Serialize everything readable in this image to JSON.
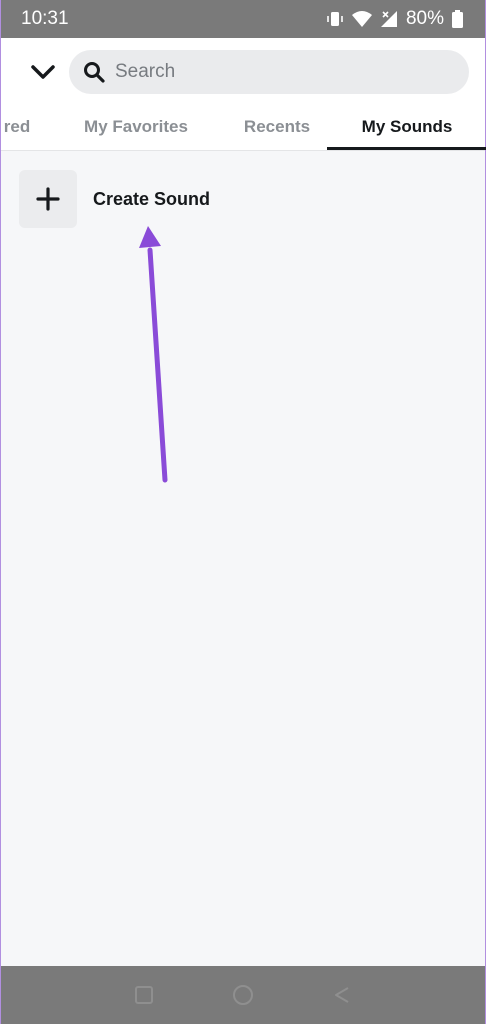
{
  "status_bar": {
    "time": "10:31",
    "battery": "80%",
    "icons": [
      "vibrate-icon",
      "wifi-icon",
      "signal-icon",
      "battery-icon"
    ]
  },
  "header": {
    "back_icon": "chevron-down-icon",
    "search": {
      "placeholder": "Search",
      "icon": "search-icon"
    }
  },
  "tabs": [
    {
      "label": "red",
      "active": false
    },
    {
      "label": "My Favorites",
      "active": false
    },
    {
      "label": "Recents",
      "active": false
    },
    {
      "label": "My Sounds",
      "active": true
    }
  ],
  "content": {
    "create": {
      "label": "Create Sound",
      "icon": "plus-icon"
    },
    "annotation": {
      "type": "arrow",
      "color": "#8a4bd8"
    }
  },
  "nav_bar": {
    "icons": [
      "recents-square-icon",
      "home-circle-icon",
      "back-triangle-icon"
    ]
  },
  "colors": {
    "accent": "#8a4bd8",
    "active_tab": "#16191c",
    "inactive_tab": "#8b8f94"
  }
}
